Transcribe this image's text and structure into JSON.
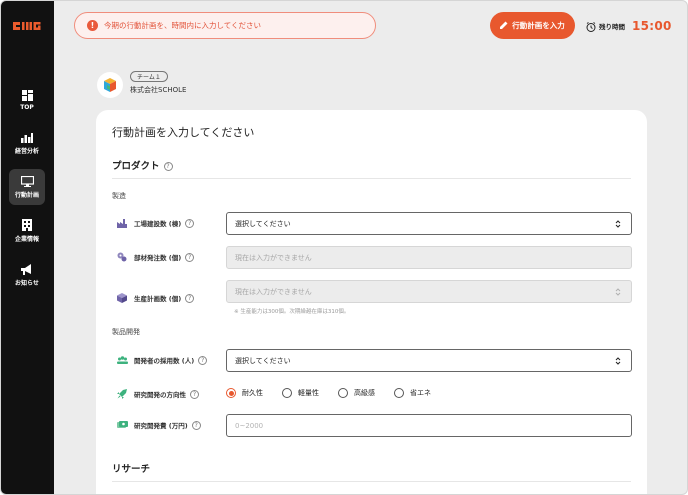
{
  "sidebar": {
    "logo": "BMG",
    "items": [
      {
        "label": "TOP",
        "icon": "grid-icon",
        "active": false
      },
      {
        "label": "経営分析",
        "icon": "bar-chart-icon",
        "active": false
      },
      {
        "label": "行動計画",
        "icon": "monitor-icon",
        "active": true
      },
      {
        "label": "企業情報",
        "icon": "building-icon",
        "active": false
      },
      {
        "label": "お知らせ",
        "icon": "megaphone-icon",
        "active": false
      }
    ]
  },
  "header": {
    "alert_icon": "!",
    "alert_text": "今期の行動計画を、時間内に入力してください",
    "primary_button": "行動計画を入力",
    "timer_label": "残り時間",
    "timer_value": "15:00"
  },
  "company": {
    "team": "チーム１",
    "name": "株式会社SCHOLE"
  },
  "form": {
    "title": "行動計画を入力してください",
    "help_mark": "?",
    "sections": {
      "product": {
        "title": "プロダクト",
        "groups": {
          "manufacturing": {
            "label": "製造",
            "rows": {
              "factories": {
                "label": "工場建設数 (棟)",
                "value": "選択してください",
                "disabled": false,
                "type": "select"
              },
              "parts": {
                "label": "部材発注数 (個)",
                "value": "現在は入力ができません",
                "disabled": true,
                "type": "input"
              },
              "production": {
                "label": "生産計画数 (個)",
                "value": "現在は入力ができません",
                "disabled": true,
                "type": "select"
              }
            },
            "note": "※ 生産能力は300個。次期繰越在庫は310個。"
          },
          "development": {
            "label": "製品開発",
            "rows": {
              "developers": {
                "label": "開発者の採用数 (人)",
                "value": "選択してください",
                "disabled": false,
                "type": "select"
              },
              "direction": {
                "label": "研究開発の方向性",
                "type": "radio",
                "options": [
                  "耐久性",
                  "軽量性",
                  "高級感",
                  "省エネ"
                ],
                "selected": "耐久性"
              },
              "cost": {
                "label": "研究開発費 (万円)",
                "placeholder": "0~2000",
                "type": "input"
              }
            }
          }
        }
      },
      "research": {
        "title": "リサーチ"
      }
    }
  },
  "colors": {
    "accent": "#e8582e",
    "sidebar": "#111111",
    "alert_bg": "#fdf0ee"
  }
}
